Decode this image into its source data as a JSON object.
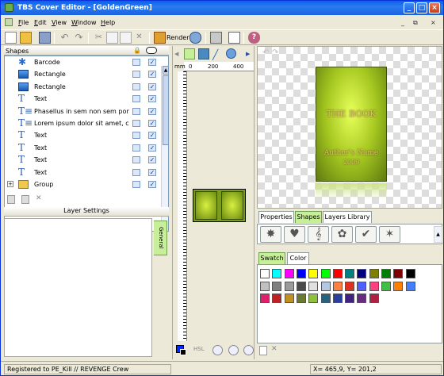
{
  "window": {
    "title": "TBS Cover Editor - [GoldenGreen]"
  },
  "menu": [
    "File",
    "Edit",
    "View",
    "Window",
    "Help"
  ],
  "toolbar": {
    "render_label": "Render"
  },
  "shapes_panel": {
    "header": "Shapes",
    "rows": [
      {
        "label": "Barcode",
        "icon": "barcode-shape-icon",
        "visible": true
      },
      {
        "label": "Rectangle",
        "icon": "rectangle-shape-icon",
        "visible": true
      },
      {
        "label": "Rectangle",
        "icon": "rectangle-shape-icon",
        "visible": true
      },
      {
        "label": "Text",
        "icon": "text-shape-icon",
        "visible": true
      },
      {
        "label": "Phasellus in sem non sem porta",
        "icon": "paragraph-shape-icon",
        "visible": true
      },
      {
        "label": "Lorem ipsum dolor sit amet, con",
        "icon": "paragraph-shape-icon",
        "visible": true
      },
      {
        "label": "Text",
        "icon": "text-shape-icon",
        "visible": true
      },
      {
        "label": "Text",
        "icon": "text-shape-icon",
        "visible": true
      },
      {
        "label": "Text",
        "icon": "text-shape-icon",
        "visible": true
      },
      {
        "label": "Text",
        "icon": "text-shape-icon",
        "visible": true
      },
      {
        "label": "Group",
        "icon": "folder-icon",
        "visible": true
      }
    ]
  },
  "layer_settings": {
    "title": "Layer Settings",
    "tab": "General"
  },
  "ruler": {
    "unit": "mm",
    "h_ticks": [
      "0",
      "200",
      "400"
    ]
  },
  "preview": {
    "book_title": "THE BOOK",
    "author": "Author's Name",
    "year": "2009"
  },
  "right_tabs": [
    {
      "label": "Properties",
      "active": false
    },
    {
      "label": "Shapes",
      "active": true
    },
    {
      "label": "Layers Library",
      "active": false
    }
  ],
  "color_tabs": [
    {
      "label": "Swatch",
      "active": true
    },
    {
      "label": "Color",
      "active": false
    }
  ],
  "swatches": [
    [
      "#ffffff",
      "#00ffff",
      "#ff00ff",
      "#0000ff",
      "#ffff00",
      "#00ff00",
      "#ff0000",
      "#008080",
      "#000080",
      "#808000",
      "#008000",
      "#800000",
      "#000000"
    ],
    [
      "#c0c0c0",
      "#808080",
      "#9b9b9b",
      "#4a4a4a",
      "#e0e0e0",
      "#b4c8e6",
      "#ff8040",
      "#e03020",
      "#5060ff",
      "#ff4080",
      "#40c040",
      "#ff8000",
      "#4080ff"
    ],
    [
      "#e0206a",
      "#c02020",
      "#c09020",
      "#6a7a30",
      "#90c040",
      "#2a6080",
      "#2a40a0",
      "#402080",
      "#6a2a80",
      "#b02040"
    ]
  ],
  "status": {
    "left": "Registered to PE_Kill // REVENGE Crew",
    "coords": "X= 465,9, Y= 201,2"
  }
}
